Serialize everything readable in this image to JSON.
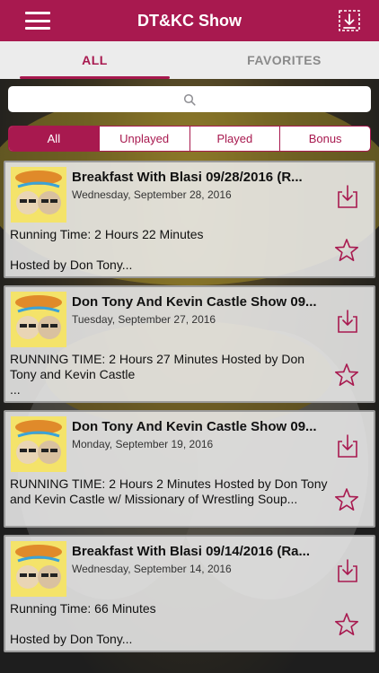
{
  "header": {
    "title": "DT&KC Show",
    "menu_icon": "hamburger-menu-icon",
    "download_icon": "download-list-icon"
  },
  "tabs": [
    {
      "label": "ALL",
      "active": true
    },
    {
      "label": "FAVORITES",
      "active": false
    }
  ],
  "search": {
    "placeholder": "",
    "value": "",
    "icon": "search-icon"
  },
  "filters": [
    {
      "label": "All",
      "active": true
    },
    {
      "label": "Unplayed",
      "active": false
    },
    {
      "label": "Played",
      "active": false
    },
    {
      "label": "Bonus",
      "active": false
    }
  ],
  "episodes": [
    {
      "title": "Breakfast With Blasi 09/28/2016 (R...",
      "date": "Wednesday, September 28, 2016",
      "description": "Running Time: 2 Hours 22 Minutes\n\nHosted by Don Tony..."
    },
    {
      "title": "Don Tony And Kevin Castle Show 09...",
      "date": "Tuesday, September 27, 2016",
      "description": "RUNNING TIME: 2 Hours 27 Minutes Hosted by Don Tony and Kevin Castle\n..."
    },
    {
      "title": "Don Tony And Kevin Castle Show 09...",
      "date": "Monday, September 19, 2016",
      "description": "RUNNING TIME: 2 Hours 2 Minutes Hosted by Don Tony and Kevin Castle w/ Missionary of Wrestling Soup..."
    },
    {
      "title": "Breakfast With Blasi 09/14/2016 (Ra...",
      "date": "Wednesday, September 14, 2016",
      "description": "Running Time: 66 Minutes\n\nHosted by Don Tony..."
    }
  ],
  "colors": {
    "accent": "#a8194f",
    "tab_bar": "#ececec",
    "card_bg": "#ececec",
    "inactive_tab": "#8a8a8a"
  }
}
